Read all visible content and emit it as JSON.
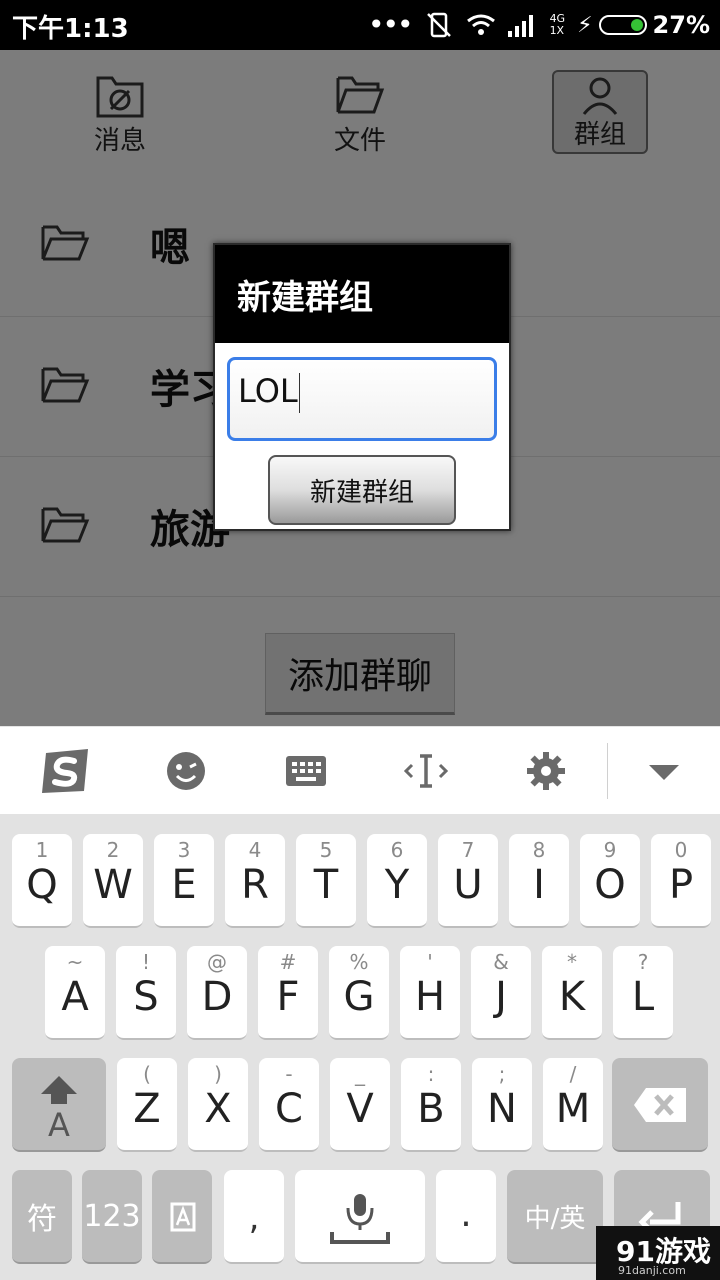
{
  "status_bar": {
    "time": "下午1:13",
    "network_top": "4G",
    "network_bottom": "1X",
    "battery_percent": "27%",
    "battery_color": "#35c235"
  },
  "tabs": [
    {
      "label": "消息",
      "icon": "message-folder-icon"
    },
    {
      "label": "文件",
      "icon": "folder-icon"
    },
    {
      "label": "群组",
      "icon": "person-icon",
      "selected": true
    }
  ],
  "groups": [
    {
      "name": "嗯"
    },
    {
      "name": "学习"
    },
    {
      "name": "旅游"
    }
  ],
  "add_group_chat_label": "添加群聊",
  "dialog": {
    "title": "新建群组",
    "input_value": "LOL",
    "button_label": "新建群组",
    "focus_color": "#3b7ee8"
  },
  "keyboard": {
    "toolbar_icons": [
      "sogou-logo-icon",
      "emoji-icon",
      "keyboard-icon",
      "cursor-move-icon",
      "settings-icon",
      "collapse-keyboard-icon"
    ],
    "row1": [
      {
        "sub": "1",
        "main": "Q"
      },
      {
        "sub": "2",
        "main": "W"
      },
      {
        "sub": "3",
        "main": "E"
      },
      {
        "sub": "4",
        "main": "R"
      },
      {
        "sub": "5",
        "main": "T"
      },
      {
        "sub": "6",
        "main": "Y"
      },
      {
        "sub": "7",
        "main": "U"
      },
      {
        "sub": "8",
        "main": "I"
      },
      {
        "sub": "9",
        "main": "O"
      },
      {
        "sub": "0",
        "main": "P"
      }
    ],
    "row2": [
      {
        "sub": "~",
        "main": "A"
      },
      {
        "sub": "!",
        "main": "S"
      },
      {
        "sub": "@",
        "main": "D"
      },
      {
        "sub": "#",
        "main": "F"
      },
      {
        "sub": "%",
        "main": "G"
      },
      {
        "sub": "'",
        "main": "H"
      },
      {
        "sub": "&",
        "main": "J"
      },
      {
        "sub": "*",
        "main": "K"
      },
      {
        "sub": "?",
        "main": "L"
      }
    ],
    "row3": [
      {
        "sub": "(",
        "main": "Z"
      },
      {
        "sub": ")",
        "main": "X"
      },
      {
        "sub": "-",
        "main": "C"
      },
      {
        "sub": "_",
        "main": "V"
      },
      {
        "sub": ":",
        "main": "B"
      },
      {
        "sub": ";",
        "main": "N"
      },
      {
        "sub": "/",
        "main": "M"
      }
    ],
    "shift_label": "A",
    "symbols_label": "符",
    "numbers_label": "123",
    "comma_label": ",",
    "period_label": ".",
    "lang_label": "中/英"
  },
  "watermark": {
    "logo": "91游戏",
    "site": "91danji.com"
  }
}
